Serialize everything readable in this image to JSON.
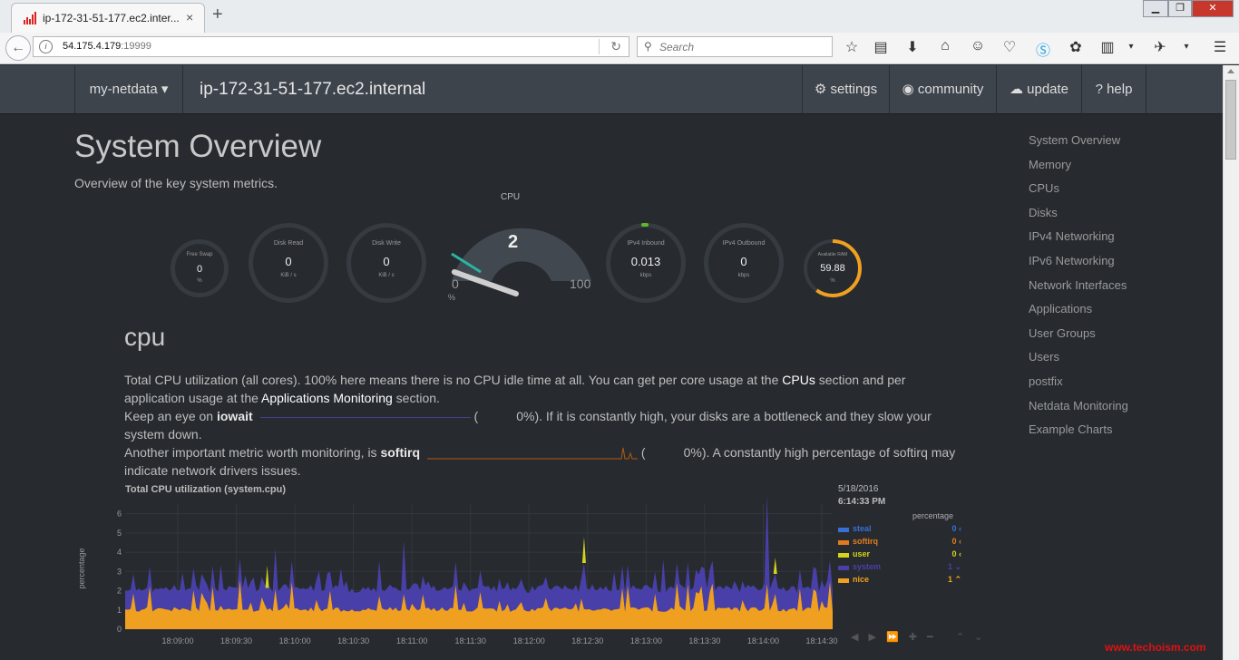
{
  "browser": {
    "tab_title": "ip-172-31-51-177.ec2.inter...",
    "tab_close": "×",
    "new_tab": "+",
    "url_host": "54.175.4.179",
    "url_port": ":19999",
    "search_placeholder": "Search",
    "window_controls": [
      "minimize",
      "maximize",
      "close"
    ]
  },
  "navbar": {
    "brand": "my-netdata ▾",
    "host": "ip-172-31-51-177.ec2.internal",
    "links": [
      {
        "label": "⚙ settings",
        "icon": "gear-icon"
      },
      {
        "label": "◉ community",
        "icon": "github-icon"
      },
      {
        "label": "☁ update",
        "icon": "cloud-download-icon"
      },
      {
        "label": "? help",
        "icon": "question-icon"
      }
    ]
  },
  "page": {
    "title": "System Overview",
    "subtitle": "Overview of the key system metrics."
  },
  "gauges": [
    {
      "label": "Free Swap",
      "value": "0",
      "unit": "%"
    },
    {
      "label": "Disk Read",
      "value": "0",
      "unit": "KiB / s"
    },
    {
      "label": "Disk Write",
      "value": "0",
      "unit": "KiB / s"
    },
    {
      "label": "IPv4 Inbound",
      "value": "0.013",
      "unit": "kbps"
    },
    {
      "label": "IPv4 Outbound",
      "value": "0",
      "unit": "kbps"
    },
    {
      "label": "Available RAM",
      "value": "59.88",
      "unit": "%",
      "fraction": 0.5988
    }
  ],
  "cpu_gauge": {
    "label": "CPU",
    "value": "2",
    "min": "0",
    "max": "100",
    "unit": "%",
    "fraction": 0.02
  },
  "section": {
    "heading": "cpu",
    "p1_a": "Total CPU utilization (all cores). 100% here means there is no CPU idle time at all. You can get per core usage at the ",
    "p1_link1": "CPUs",
    "p1_b": " section and per application usage at the ",
    "p1_link2": "Applications Monitoring",
    "p1_c": " section.",
    "p2_a": "Keep an eye on ",
    "p2_b": "iowait",
    "p2_c": "0%). If it is constantly high, your disks are a bottleneck and they slow your system down.",
    "p3_a": "Another important metric worth monitoring, is ",
    "p3_b": "softirq",
    "p3_c": "0%). A constantly high percentage of softirq may indicate network drivers issues.",
    "paren": "("
  },
  "chart_data": {
    "type": "area",
    "title": "Total CPU utilization (system.cpu)",
    "ylabel": "percentage",
    "ylim": [
      0,
      6.5
    ],
    "yticks": [
      "0",
      "1",
      "2",
      "3",
      "4",
      "5",
      "6"
    ],
    "xticks": [
      "18:09:00",
      "18:09:30",
      "18:10:00",
      "18:10:30",
      "18:11:00",
      "18:11:30",
      "18:12:00",
      "18:12:30",
      "18:13:00",
      "18:13:30",
      "18:14:00",
      "18:14:30"
    ],
    "date": "5/18/2016",
    "time": "6:14:33 PM",
    "legend_unit": "percentage",
    "series": [
      {
        "name": "steal",
        "value": "0",
        "arrow": "‹",
        "color": "#3a6fd6"
      },
      {
        "name": "softirq",
        "value": "0",
        "arrow": "‹",
        "color": "#e27b1e"
      },
      {
        "name": "user",
        "value": "0",
        "arrow": "‹",
        "color": "#d4d41a"
      },
      {
        "name": "system",
        "value": "1",
        "arrow": "⌄",
        "color": "#4840a8"
      },
      {
        "name": "nice",
        "value": "1",
        "arrow": "⌃",
        "color": "#f0a020"
      }
    ]
  },
  "toc": [
    "System Overview",
    "Memory",
    "CPUs",
    "Disks",
    "IPv4 Networking",
    "IPv6 Networking",
    "Network Interfaces",
    "Applications",
    "User Groups",
    "Users",
    "postfix",
    "Netdata Monitoring",
    "Example Charts"
  ],
  "watermark": "www.techoism.com"
}
